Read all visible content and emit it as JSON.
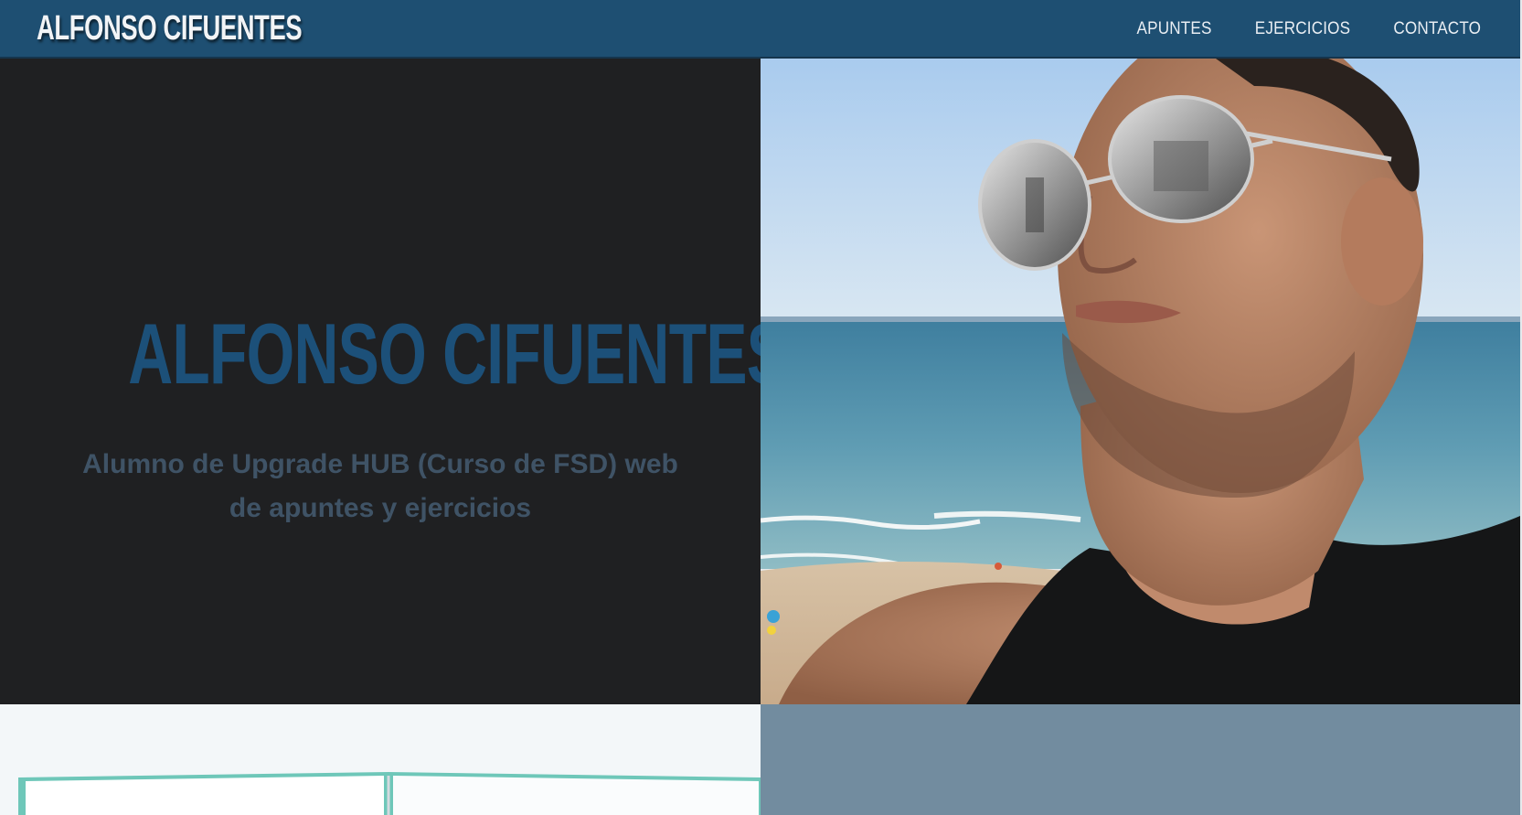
{
  "navbar": {
    "brand": "ALFONSO CIFUENTES",
    "links": [
      {
        "label": "APUNTES"
      },
      {
        "label": "EJERCICIOS"
      },
      {
        "label": "CONTACTO"
      }
    ],
    "background_color": "#1e4f72"
  },
  "hero": {
    "title": "ALFONSO CIFUENTES",
    "subtitle": "Alumno de Upgrade HUB (Curso de FSD) web de apuntes y ejercicios",
    "title_color": "#1c5079",
    "panel_color": "#1f2022"
  },
  "colors": {
    "accent": "#1e4f72",
    "row2_right_panel": "#728c9f"
  }
}
